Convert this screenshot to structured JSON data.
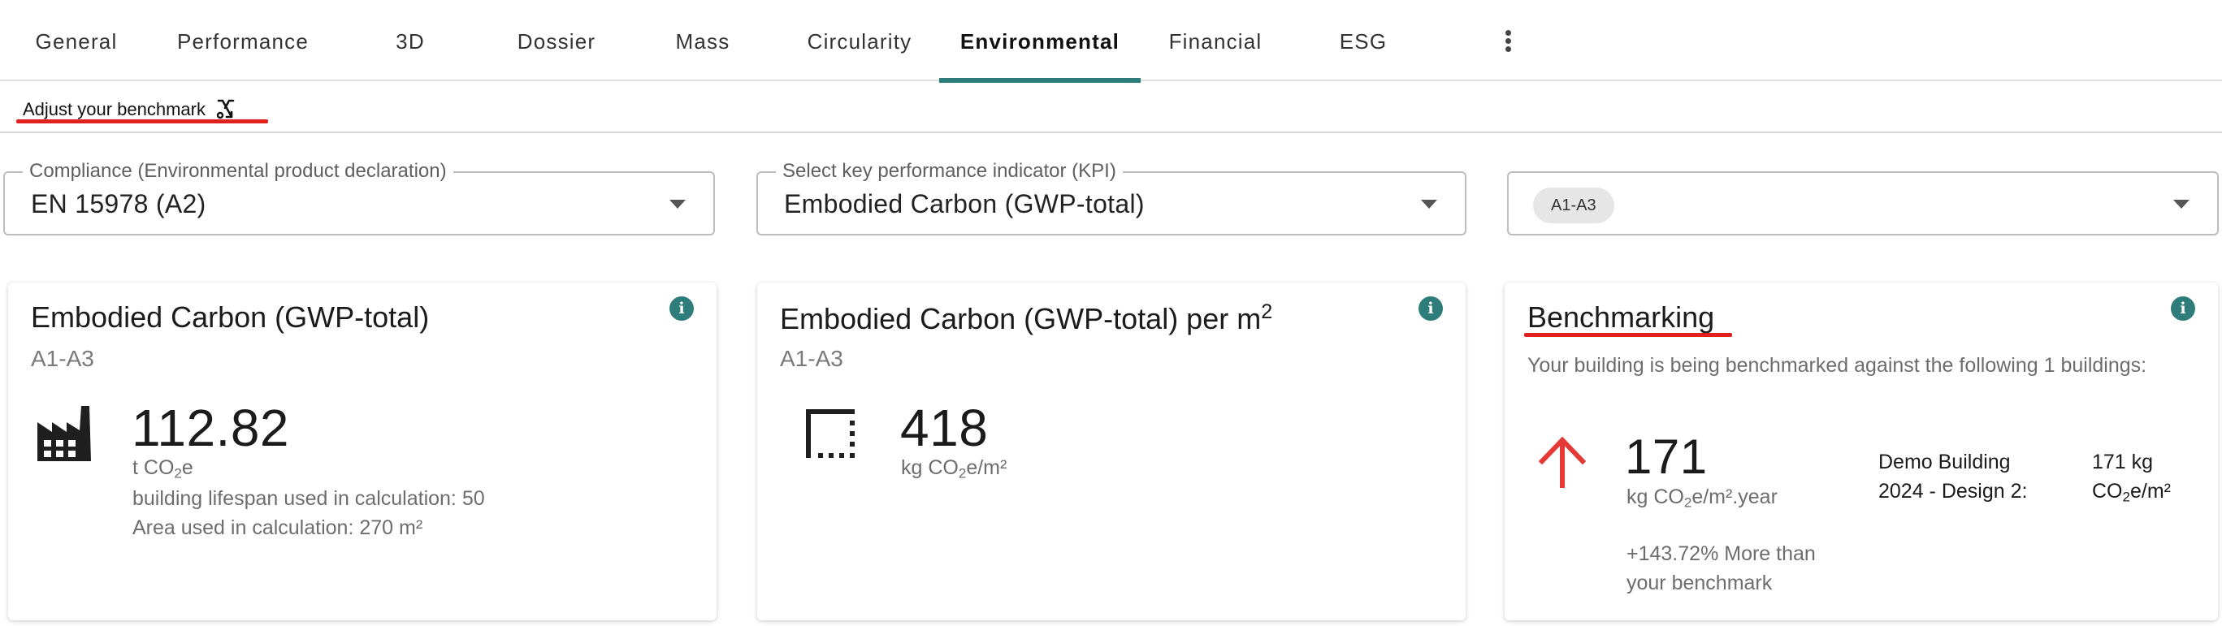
{
  "tabs": [
    {
      "label": "General",
      "active": false
    },
    {
      "label": "Performance",
      "active": false
    },
    {
      "label": "3D",
      "active": false
    },
    {
      "label": "Dossier",
      "active": false
    },
    {
      "label": "Mass",
      "active": false
    },
    {
      "label": "Circularity",
      "active": false
    },
    {
      "label": "Environmental",
      "active": true
    },
    {
      "label": "Financial",
      "active": false
    },
    {
      "label": "ESG",
      "active": false
    }
  ],
  "benchmark_bar": {
    "adjust_label": "Adjust your benchmark"
  },
  "filters": {
    "compliance": {
      "legend": "Compliance (Environmental product declaration)",
      "value": "EN 15978 (A2)"
    },
    "kpi": {
      "legend": "Select key performance indicator (KPI)",
      "value": "Embodied Carbon (GWP-total)"
    },
    "stages": {
      "chip": "A1-A3"
    }
  },
  "cards": {
    "total": {
      "title": "Embodied Carbon (GWP-total)",
      "subtitle": "A1-A3",
      "value": "112.82",
      "unit_pre": "t CO",
      "unit_sub": "2",
      "unit_post": "e",
      "lifespan": "building lifespan used in calculation: 50",
      "area": "Area used in calculation: 270 m²"
    },
    "per_m2": {
      "title_pre": "Embodied Carbon (GWP-total) per m",
      "title_sup": "2",
      "subtitle": "A1-A3",
      "value": "418",
      "unit_pre": "kg CO",
      "unit_sub": "2",
      "unit_post": "e/m²"
    },
    "benchmarking": {
      "title": "Benchmarking",
      "description": "Your building is being benchmarked against the following 1 buildings:",
      "value": "171",
      "unit_pre": "kg CO",
      "unit_sub": "2",
      "unit_post": "e/m².year",
      "difference": "+143.72% More than your benchmark",
      "comparison": {
        "name": "Demo Building 2024 - Design 2:",
        "value_line1": "171 kg",
        "value_pre": "CO",
        "value_sub": "2",
        "value_post": "e/m²"
      }
    }
  },
  "colors": {
    "accent": "#2e7d7a",
    "highlight": "#e0211f",
    "arrow": "#e53935"
  }
}
